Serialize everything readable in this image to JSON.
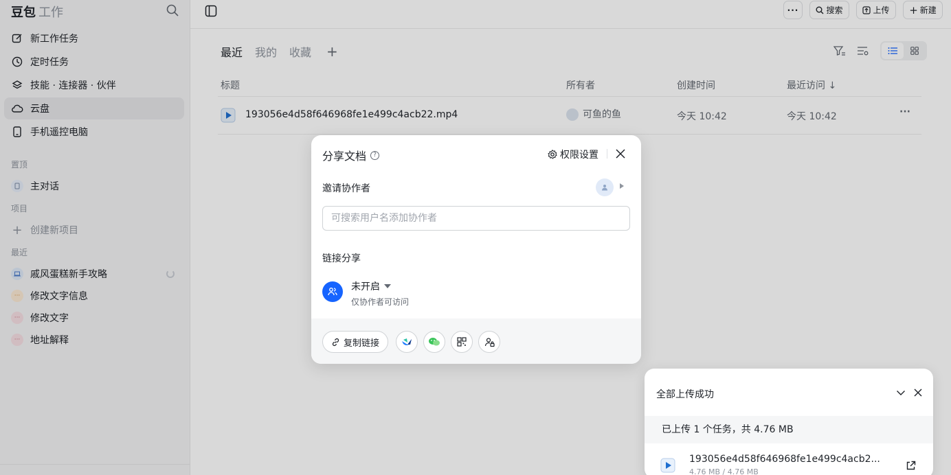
{
  "app": {
    "brand": "豆包",
    "brand_sub": "工作"
  },
  "sidebar": {
    "nav": [
      {
        "label": "新工作任务",
        "icon": "edit-icon"
      },
      {
        "label": "定时任务",
        "icon": "clock-icon"
      },
      {
        "label": "技能 · 连接器 · 伙伴",
        "icon": "layers-icon"
      },
      {
        "label": "云盘",
        "icon": "cloud-icon",
        "active": true
      },
      {
        "label": "手机遥控电脑",
        "icon": "phone-icon"
      }
    ],
    "pinned_label": "置顶",
    "pinned": [
      {
        "label": "主对话"
      }
    ],
    "projects_label": "项目",
    "create_project": "创建新项目",
    "recent_label": "最近",
    "recent": [
      {
        "label": "戚风蛋糕新手攻略"
      },
      {
        "label": "修改文字信息"
      },
      {
        "label": "修改文字"
      },
      {
        "label": "地址解释"
      }
    ]
  },
  "toolbar": {
    "search": "搜索",
    "upload": "上传",
    "new": "新建"
  },
  "tabs": [
    {
      "label": "最近",
      "active": true
    },
    {
      "label": "我的"
    },
    {
      "label": "收藏"
    }
  ],
  "table": {
    "headers": {
      "title": "标题",
      "owner": "所有者",
      "created": "创建时间",
      "visited": "最近访问 ↓"
    },
    "rows": [
      {
        "title": "193056e4d58f646968fe1e499c4acb22.mp4",
        "owner": "可鱼的鱼",
        "created": "今天 10:42",
        "visited": "今天 10:42"
      }
    ]
  },
  "share_dialog": {
    "title": "分享文档",
    "permissions": "权限设置",
    "invite_label": "邀请协作者",
    "invite_placeholder": "可搜索用户名添加协作者",
    "link_label": "链接分享",
    "link_status": "未开启",
    "link_desc": "仅协作者可访问",
    "copy_link": "复制链接"
  },
  "upload_panel": {
    "title": "全部上传成功",
    "summary": "已上传 1 个任务，共 4.76 MB",
    "file_name": "193056e4d58f646968fe1e499c4acb2...",
    "file_size": "4.76 MB / 4.76 MB"
  },
  "colors": {
    "accent": "#1664ff",
    "overlay": "rgba(0,0,0,0.15)"
  }
}
